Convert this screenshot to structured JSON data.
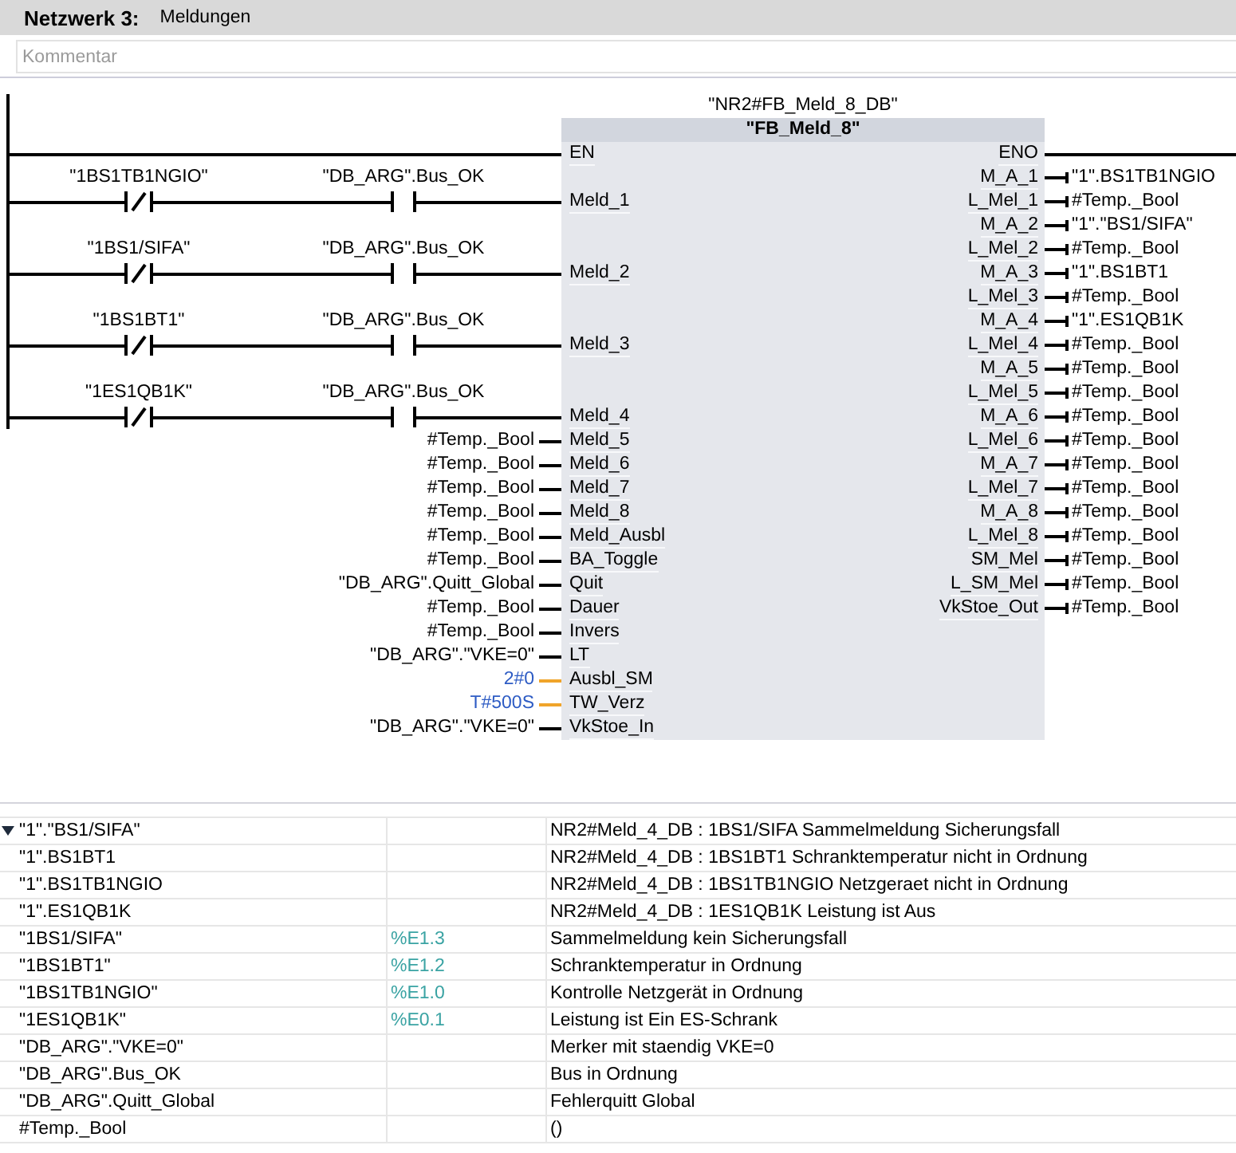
{
  "network": {
    "number": "Netzwerk 3:",
    "title": "Meldungen",
    "comment": {
      "placeholder": "Kommentar"
    }
  },
  "block": {
    "instance": "\"NR2#FB_Meld_8_DB\"",
    "name": "\"FB_Meld_8\"",
    "enable_in": "EN",
    "enable_out": "ENO",
    "inputs": [
      {
        "pin": "Meld_1",
        "kind": "contacts",
        "contacts": [
          {
            "kind": "nc",
            "operand": "\"1BS1TB1NGIO\""
          },
          {
            "kind": "no",
            "operand": "\"DB_ARG\".Bus_OK"
          }
        ]
      },
      {
        "pin": "Meld_2",
        "kind": "contacts",
        "contacts": [
          {
            "kind": "nc",
            "operand": "\"1BS1/SIFA\""
          },
          {
            "kind": "no",
            "operand": "\"DB_ARG\".Bus_OK"
          }
        ]
      },
      {
        "pin": "Meld_3",
        "kind": "contacts",
        "contacts": [
          {
            "kind": "nc",
            "operand": "\"1BS1BT1\""
          },
          {
            "kind": "no",
            "operand": "\"DB_ARG\".Bus_OK"
          }
        ]
      },
      {
        "pin": "Meld_4",
        "kind": "contacts",
        "contacts": [
          {
            "kind": "nc",
            "operand": "\"1ES1QB1K\""
          },
          {
            "kind": "no",
            "operand": "\"DB_ARG\".Bus_OK"
          }
        ]
      },
      {
        "pin": "Meld_5",
        "kind": "variable",
        "operand": "#Temp._Bool"
      },
      {
        "pin": "Meld_6",
        "kind": "variable",
        "operand": "#Temp._Bool"
      },
      {
        "pin": "Meld_7",
        "kind": "variable",
        "operand": "#Temp._Bool"
      },
      {
        "pin": "Meld_8",
        "kind": "variable",
        "operand": "#Temp._Bool"
      },
      {
        "pin": "Meld_Ausbl",
        "kind": "variable",
        "operand": "#Temp._Bool"
      },
      {
        "pin": "BA_Toggle",
        "kind": "variable",
        "operand": "#Temp._Bool"
      },
      {
        "pin": "Quit",
        "kind": "variable",
        "operand": "\"DB_ARG\".Quitt_Global"
      },
      {
        "pin": "Dauer",
        "kind": "variable",
        "operand": "#Temp._Bool"
      },
      {
        "pin": "Invers",
        "kind": "variable",
        "operand": "#Temp._Bool"
      },
      {
        "pin": "LT",
        "kind": "variable",
        "operand": "\"DB_ARG\".\"VKE=0\""
      },
      {
        "pin": "Ausbl_SM",
        "kind": "constant",
        "operand": "2#0"
      },
      {
        "pin": "TW_Verz",
        "kind": "constant",
        "operand": "T#500S"
      },
      {
        "pin": "VkStoe_In",
        "kind": "variable",
        "operand": "\"DB_ARG\".\"VKE=0\""
      }
    ],
    "outputs": [
      {
        "pin": "M_A_1",
        "operand": "\"1\".BS1TB1NGIO"
      },
      {
        "pin": "L_Mel_1",
        "operand": "#Temp._Bool"
      },
      {
        "pin": "M_A_2",
        "operand": "\"1\".\"BS1/SIFA\""
      },
      {
        "pin": "L_Mel_2",
        "operand": "#Temp._Bool"
      },
      {
        "pin": "M_A_3",
        "operand": "\"1\".BS1BT1"
      },
      {
        "pin": "L_Mel_3",
        "operand": "#Temp._Bool"
      },
      {
        "pin": "M_A_4",
        "operand": "\"1\".ES1QB1K"
      },
      {
        "pin": "L_Mel_4",
        "operand": "#Temp._Bool"
      },
      {
        "pin": "M_A_5",
        "operand": "#Temp._Bool"
      },
      {
        "pin": "L_Mel_5",
        "operand": "#Temp._Bool"
      },
      {
        "pin": "M_A_6",
        "operand": "#Temp._Bool"
      },
      {
        "pin": "L_Mel_6",
        "operand": "#Temp._Bool"
      },
      {
        "pin": "M_A_7",
        "operand": "#Temp._Bool"
      },
      {
        "pin": "L_Mel_7",
        "operand": "#Temp._Bool"
      },
      {
        "pin": "M_A_8",
        "operand": "#Temp._Bool"
      },
      {
        "pin": "L_Mel_8",
        "operand": "#Temp._Bool"
      },
      {
        "pin": "SM_Mel",
        "operand": "#Temp._Bool"
      },
      {
        "pin": "L_SM_Mel",
        "operand": "#Temp._Bool"
      },
      {
        "pin": "VkStoe_Out",
        "operand": "#Temp._Bool"
      }
    ]
  },
  "table": {
    "rows": [
      {
        "kind": "group",
        "expanded": true,
        "column_1": "\"1\".\"BS1/SIFA\"",
        "column_3": "NR2#Meld_4_DB : 1BS1/SIFA Sammelmeldung Sicherungsfall"
      },
      {
        "kind": "entry",
        "column_1": "\"1\".BS1BT1",
        "column_3": "NR2#Meld_4_DB : 1BS1BT1 Schranktemperatur nicht in Ordnung"
      },
      {
        "kind": "entry",
        "column_1": "\"1\".BS1TB1NGIO",
        "column_3": "NR2#Meld_4_DB : 1BS1TB1NGIO Netzgeraet nicht in Ordnung"
      },
      {
        "kind": "entry",
        "column_1": "\"1\".ES1QB1K",
        "column_3": "NR2#Meld_4_DB : 1ES1QB1K Leistung ist Aus"
      },
      {
        "kind": "entry",
        "column_1": "\"1BS1/SIFA\"",
        "column_2": "%E1.3",
        "column_3": "Sammelmeldung kein Sicherungsfall"
      },
      {
        "kind": "entry",
        "column_1": "\"1BS1BT1\"",
        "column_2": "%E1.2",
        "column_3": "Schranktemperatur in Ordnung"
      },
      {
        "kind": "entry",
        "column_1": "\"1BS1TB1NGIO\"",
        "column_2": "%E1.0",
        "column_3": "Kontrolle Netzgerät in Ordnung"
      },
      {
        "kind": "entry",
        "column_1": "\"1ES1QB1K\"",
        "column_2": "%E0.1",
        "column_3": "Leistung ist Ein ES-Schrank"
      },
      {
        "kind": "entry",
        "column_1": "\"DB_ARG\".\"VKE=0\"",
        "column_3": "Merker mit staendig VKE=0"
      },
      {
        "kind": "entry",
        "column_1": "\"DB_ARG\".Bus_OK",
        "column_3": "Bus in Ordnung"
      },
      {
        "kind": "entry",
        "column_1": "\"DB_ARG\".Quitt_Global",
        "column_3": "Fehlerquitt Global"
      },
      {
        "kind": "entry",
        "column_1": "#Temp._Bool",
        "column_3": "()"
      }
    ]
  }
}
